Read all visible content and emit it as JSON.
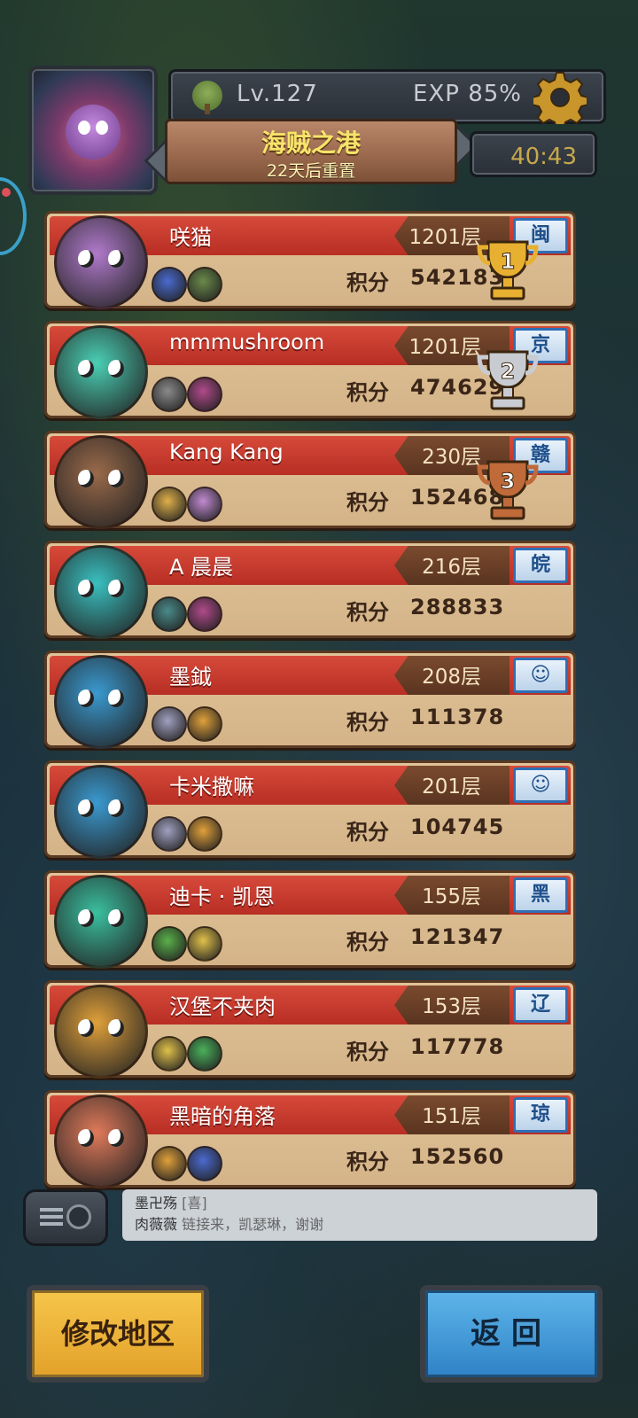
{
  "header": {
    "level": "Lv.127",
    "exp": "EXP 85%",
    "map_name": "海贼之港",
    "reset_text": "22天后重置",
    "timer": "40:43"
  },
  "rankings": [
    {
      "name": "咲猫",
      "floor": "1201层",
      "score_label": "积分",
      "score": "542183",
      "region": "闽",
      "trophy": "gold",
      "trophy_num": "1",
      "hero_color": "#b07acb",
      "pets": [
        "#4a6ad0",
        "#6a8a4a"
      ]
    },
    {
      "name": "mmmushroom",
      "floor": "1201层",
      "score_label": "积分",
      "score": "474629",
      "region": "京",
      "trophy": "silver",
      "trophy_num": "2",
      "hero_color": "#4ad0b5",
      "pets": [
        "#8a8a8a",
        "#b04a8a"
      ]
    },
    {
      "name": "Kang Kang",
      "floor": "230层",
      "score_label": "积分",
      "score": "152468",
      "region": "赣",
      "trophy": "bronze",
      "trophy_num": "3",
      "hero_color": "#9a6a4a",
      "pets": [
        "#e0b04a",
        "#c08ad0"
      ]
    },
    {
      "name": "A 晨晨",
      "floor": "216层",
      "score_label": "积分",
      "score": "288833",
      "region": "皖",
      "trophy": "",
      "trophy_num": "",
      "hero_color": "#3ac0c0",
      "pets": [
        "#4a8a8a",
        "#b04a8a"
      ]
    },
    {
      "name": "墨鉞",
      "floor": "208层",
      "score_label": "积分",
      "score": "111378",
      "region": "☺",
      "trophy": "",
      "trophy_num": "",
      "hero_color": "#3a9ad0",
      "pets": [
        "#a0a0c0",
        "#e0a03a"
      ]
    },
    {
      "name": "卡米撒嘛",
      "floor": "201层",
      "score_label": "积分",
      "score": "104745",
      "region": "☺",
      "trophy": "",
      "trophy_num": "",
      "hero_color": "#3a9ad0",
      "pets": [
        "#a0a0c0",
        "#e0a03a"
      ]
    },
    {
      "name": "迪卡 · 凯恩",
      "floor": "155层",
      "score_label": "积分",
      "score": "121347",
      "region": "黑",
      "trophy": "",
      "trophy_num": "",
      "hero_color": "#3ac0a0",
      "pets": [
        "#5ab04a",
        "#e0c04a"
      ]
    },
    {
      "name": "汉堡不夹肉",
      "floor": "153层",
      "score_label": "积分",
      "score": "117778",
      "region": "辽",
      "trophy": "",
      "trophy_num": "",
      "hero_color": "#e0a03a",
      "pets": [
        "#e0c04a",
        "#4ab05a"
      ]
    },
    {
      "name": "黑暗的角落",
      "floor": "151层",
      "score_label": "积分",
      "score": "152560",
      "region": "琼",
      "trophy": "",
      "trophy_num": "",
      "hero_color": "#e07a5a",
      "pets": [
        "#e0a03a",
        "#4a6ad0"
      ]
    }
  ],
  "chat": {
    "line1_user": "墨卍殇",
    "line1_tag": "[喜]",
    "line2_user": "肉薇薇",
    "line2_msg": "链接来，凯瑟琳，谢谢"
  },
  "buttons": {
    "change_region": "修改地区",
    "back": "返回"
  },
  "colors": {
    "banner_red": "#c53a2e",
    "card_tan": "#d9ba8e",
    "region_blue": "#2e6fb5",
    "gold": "#e8b030",
    "silver": "#c8ccd2",
    "bronze": "#c06a3a"
  }
}
